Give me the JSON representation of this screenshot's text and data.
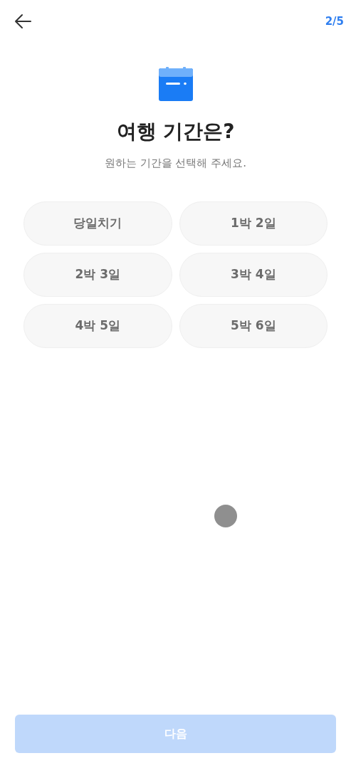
{
  "header": {
    "progress": "2/5"
  },
  "title": "여행 기간은?",
  "subtitle": "원하는 기간을 선택해 주세요.",
  "options": [
    {
      "label": "당일치기",
      "selected": false
    },
    {
      "label": "1박 2일",
      "selected": false
    },
    {
      "label": "2박 3일",
      "selected": false
    },
    {
      "label": "3박 4일",
      "selected": false
    },
    {
      "label": "4박 5일",
      "selected": false
    },
    {
      "label": "5박 6일",
      "selected": false
    }
  ],
  "next_button": {
    "label": "다음",
    "disabled": true
  }
}
